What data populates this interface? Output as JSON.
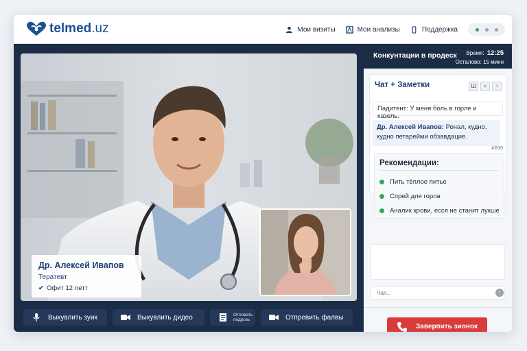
{
  "brand": {
    "name": "telmed",
    "tld": ".uz"
  },
  "nav": [
    {
      "label": "Мои визиты",
      "icon": "user-icon"
    },
    {
      "label": "Мои анализы",
      "icon": "lab-icon"
    },
    {
      "label": "Поддержка",
      "icon": "phone-icon"
    }
  ],
  "doctor": {
    "name": "Др. Алексей Ивапов",
    "specialty": "Тератевт",
    "experience": "Офит 12 летт"
  },
  "controls": {
    "mic": "Выкувлить зуик",
    "video": "Выкувлить дидео",
    "report": "Отповать подрозь",
    "files": "Отпревить фалвы"
  },
  "session": {
    "title": "Конкунтации в продеск",
    "time_label": "Время:",
    "time": "12:25",
    "remaining": "Осталово: 15 минн"
  },
  "chat": {
    "title": "Чат + Заметки",
    "tools": [
      "Ш",
      "+",
      "↑"
    ],
    "patient_msg": "Падитент: У меня боль в горле и казель.",
    "doctor_author": "Др. Алексей Ивапов:",
    "doctor_msg": "Ронал, кудно, кудно петарейми обзавдацие.",
    "timestamp": "АВ30"
  },
  "recommendations": {
    "title": "Рекомендации:",
    "items": [
      "Пить тёплое питье",
      "Спрей для горла",
      "Аналик крови, есся не станит лукше"
    ]
  },
  "input": {
    "placeholder": "Чая..."
  },
  "end_call": {
    "label": "Заверпить зионок"
  },
  "colors": {
    "navy": "#1b2c47",
    "accent": "#1d3f72",
    "danger": "#d93a3a",
    "success": "#3aa55a"
  }
}
